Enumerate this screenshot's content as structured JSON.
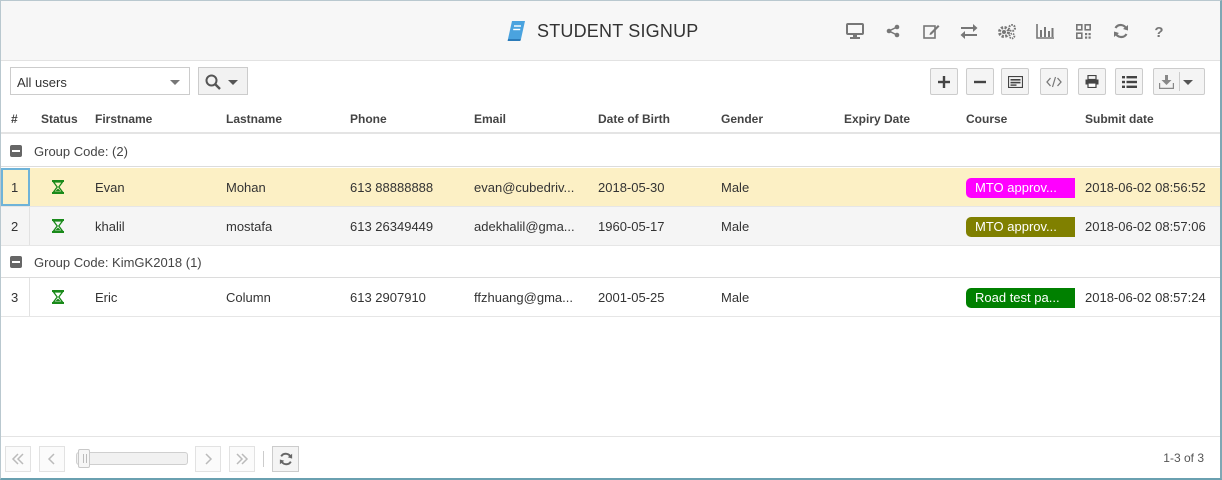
{
  "header": {
    "title": "STUDENT SIGNUP",
    "icons": [
      "monitor-icon",
      "share-icon",
      "edit-icon",
      "swap-icon",
      "settings-icon",
      "bar-chart-icon",
      "qr-code-icon",
      "refresh-icon",
      "help-icon"
    ]
  },
  "toolbar": {
    "user_filter_value": "All users",
    "buttons": [
      "add",
      "remove",
      "form-view",
      "embed-code",
      "print",
      "list-view",
      "download"
    ]
  },
  "columns": [
    "#",
    "Status",
    "Firstname",
    "Lastname",
    "Phone",
    "Email",
    "Date of Birth",
    "Gender",
    "Expiry Date",
    "Course",
    "Submit date"
  ],
  "groups": [
    {
      "label": "Group Code: (2)",
      "rows": [
        {
          "num": "1",
          "firstname": "Evan",
          "lastname": "Mohan",
          "phone": "613 88888888",
          "email": "evan@cubedriv...",
          "dob": "2018-05-30",
          "gender": "Male",
          "expiry": "",
          "course": "MTO approv...",
          "course_color": "#ff00ff",
          "submit": "2018-06-02 08:56:52"
        },
        {
          "num": "2",
          "firstname": "khalil",
          "lastname": "mostafa",
          "phone": "613 26349449",
          "email": "adekhalil@gma...",
          "dob": "1960-05-17",
          "gender": "Male",
          "expiry": "",
          "course": "MTO approv...",
          "course_color": "#808000",
          "submit": "2018-06-02 08:57:06"
        }
      ]
    },
    {
      "label": "Group Code: KimGK2018 (1)",
      "rows": [
        {
          "num": "3",
          "firstname": "Eric",
          "lastname": "Column",
          "phone": "613 2907910",
          "email": "ffzhuang@gma...",
          "dob": "2001-05-25",
          "gender": "Male",
          "expiry": "",
          "course": "Road test pa...",
          "course_color": "#008000",
          "submit": "2018-06-02 08:57:24"
        }
      ]
    }
  ],
  "status_icon": "hourglass-icon",
  "colors": {
    "status_icon": "#1a8a1a",
    "title_icon": "#4aa3df",
    "selected_row": "#fcf0c5"
  },
  "footer": {
    "page_info": "1-3 of 3"
  }
}
